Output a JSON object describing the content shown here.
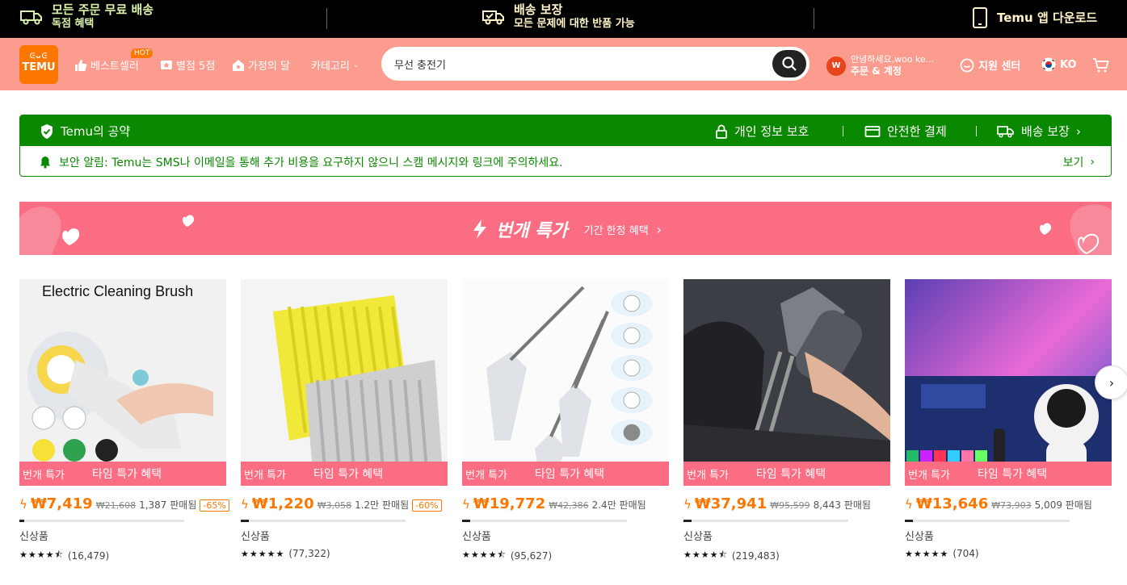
{
  "topbar": {
    "shipping_l1": "모든 주문 무료 배송",
    "shipping_l2": "독점 혜택",
    "guarantee_l1": "배송 보장",
    "guarantee_l2": "모든 문제에 대한 반품 가능",
    "app": "Temu 앱 다운로드"
  },
  "header": {
    "logo_top": "ᕮᴗᕮ",
    "logo_text": "TEMU",
    "nav": {
      "bestseller": "베스트셀러",
      "hot_badge": "HOT",
      "five_star": "별점 5점",
      "home": "가정의 달",
      "category": "카테고리"
    },
    "search": {
      "value": "무선 충전기"
    },
    "user": {
      "avatar_letter": "W",
      "greeting": "안녕하세요,woo ke...",
      "orders": "주문 & 계정"
    },
    "support": "지원 센터",
    "language": "KO"
  },
  "promise": {
    "title": "Temu의 공약",
    "items": [
      "개인 정보 보호",
      "안전한 결제",
      "배송 보장"
    ],
    "alert": "보안 알림: Temu는 SMS나 이메일을 통해 추가 비용을 요구하지 않으니 스캠 메시지와 링크에 주의하세요.",
    "more": "보기"
  },
  "banner": {
    "title": "번개 특가",
    "subtitle": "기간 한정 혜택"
  },
  "deal_labels": {
    "a": "번개 특가",
    "b": "타임 특가 혜택"
  },
  "products": [
    {
      "image_caption": "Electric Cleaning Brush",
      "price": "₩7,419",
      "original": "₩21,608",
      "sold": "1,387 판매됨",
      "discount": "-65%",
      "tag": "신상품",
      "stars": "★★★★⯪",
      "reviews": "(16,479)",
      "progress": 0.03
    },
    {
      "image_caption": "",
      "price": "₩1,220",
      "original": "₩3,058",
      "sold": "1.2만 판매됨",
      "discount": "-60%",
      "tag": "신상품",
      "stars": "★★★★★",
      "reviews": "(77,322)",
      "progress": 0.05
    },
    {
      "image_caption": "",
      "price": "₩19,772",
      "original": "₩42,386",
      "sold": "2.4만 판매됨",
      "discount": "",
      "tag": "신상품",
      "stars": "★★★★⯪",
      "reviews": "(95,627)",
      "progress": 0.05
    },
    {
      "image_caption": "",
      "price": "₩37,941",
      "original": "₩95,599",
      "sold": "8,443 판매됨",
      "discount": "",
      "tag": "신상품",
      "stars": "★★★★⯪",
      "reviews": "(219,483)",
      "progress": 0.05
    },
    {
      "image_caption": "",
      "price": "₩13,646",
      "original": "₩73,903",
      "sold": "5,009 판매됨",
      "discount": "",
      "tag": "신상품",
      "stars": "★★★★★",
      "reviews": "(704)",
      "progress": 0.05
    }
  ],
  "colors": {
    "accent": "#fb7701",
    "header": "#fb9c8f",
    "green": "#0a8800",
    "pink": "#fb6d82"
  }
}
